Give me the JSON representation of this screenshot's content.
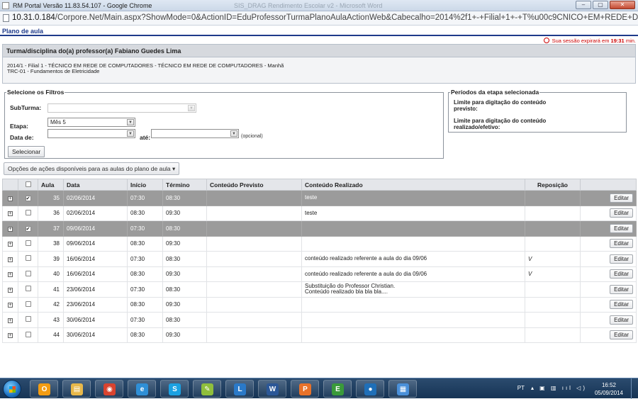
{
  "window": {
    "title": "RM Portal Versão 11.83.54.107 - Google Chrome",
    "blurred_title": "SIS_DRAG Rendimento Escolar v2 - Microsoft Word",
    "minimize": "–",
    "maximize": "▢",
    "close": "✕"
  },
  "address": {
    "host": "10.31.0.184",
    "path": "/Corpore.Net/Main.aspx?ShowMode=0&ActionID=EduProfessorTurmaPlanoAulaActionWeb&Cabecalho=2014%2f1+-+Filial+1+-+T%u00c9CNICO+EM+REDE+DE+CO"
  },
  "page": {
    "title": "Plano de aula",
    "session_prefix": "Sua sessão expirará em",
    "session_time": "19:31",
    "session_unit": "min."
  },
  "class_box": {
    "heading": "Turma/disciplina do(a) professor(a) Fabiano Guedes Lima",
    "line1": "2014/1 - Filial 1 - TÉCNICO EM REDE DE COMPUTADORES - TÉCNICO EM REDE DE COMPUTADORES - Manhã",
    "line2": "TRC-01 - Fundamentos de Eletricidade"
  },
  "filters": {
    "legend": "Selecione os Filtros",
    "subturma_label": "SubTurma:",
    "subturma_value": "",
    "etapa_label": "Etapa:",
    "etapa_value": "Mês 5",
    "data_de_label": "Data de:",
    "ate_label": "até:",
    "optional": "(opcional)",
    "select_button": "Selecionar"
  },
  "periods": {
    "legend": "Períodos da etapa selecionada",
    "previsto_label": "Limite para digitação do conteúdo previsto:",
    "realizado_label": "Limite para digitação do conteúdo realizado/efetivo:"
  },
  "actions_button": "Opções de ações disponíveis para as aulas do plano de aula ▾",
  "table": {
    "headers": [
      "",
      "",
      "Aula",
      "Data",
      "Início",
      "Término",
      "Conteúdo Previsto",
      "Conteúdo Realizado",
      "Reposição",
      ""
    ],
    "edit_label": "Editar",
    "rows": [
      {
        "aula": "35",
        "data": "02/06/2014",
        "inicio": "07:30",
        "termino": "08:30",
        "previsto": "",
        "realizado": "teste",
        "realizado2": "",
        "reposicao": "",
        "checked": "✔",
        "selected": true
      },
      {
        "aula": "36",
        "data": "02/06/2014",
        "inicio": "08:30",
        "termino": "09:30",
        "previsto": "",
        "realizado": "teste",
        "realizado2": "",
        "reposicao": "",
        "checked": "",
        "selected": false
      },
      {
        "aula": "37",
        "data": "09/06/2014",
        "inicio": "07:30",
        "termino": "08:30",
        "previsto": "",
        "realizado": "",
        "realizado2": "",
        "reposicao": "",
        "checked": "✔",
        "selected": true
      },
      {
        "aula": "38",
        "data": "09/06/2014",
        "inicio": "08:30",
        "termino": "09:30",
        "previsto": "",
        "realizado": "",
        "realizado2": "",
        "reposicao": "",
        "checked": "",
        "selected": false
      },
      {
        "aula": "39",
        "data": "16/06/2014",
        "inicio": "07:30",
        "termino": "08:30",
        "previsto": "",
        "realizado": "conteúdo realizado referente a aula do dia 09/06",
        "realizado2": "",
        "reposicao": "V",
        "checked": "",
        "selected": false
      },
      {
        "aula": "40",
        "data": "16/06/2014",
        "inicio": "08:30",
        "termino": "09:30",
        "previsto": "",
        "realizado": "conteúdo realizado referente a aula do dia 09/06",
        "realizado2": "",
        "reposicao": "V",
        "checked": "",
        "selected": false
      },
      {
        "aula": "41",
        "data": "23/06/2014",
        "inicio": "07:30",
        "termino": "08:30",
        "previsto": "",
        "realizado": "Substituição do Professor Christian.",
        "realizado2": "Conteúdo realizado bla bla bla....",
        "reposicao": "",
        "checked": "",
        "selected": false
      },
      {
        "aula": "42",
        "data": "23/06/2014",
        "inicio": "08:30",
        "termino": "09:30",
        "previsto": "",
        "realizado": "",
        "realizado2": "",
        "reposicao": "",
        "checked": "",
        "selected": false
      },
      {
        "aula": "43",
        "data": "30/06/2014",
        "inicio": "07:30",
        "termino": "08:30",
        "previsto": "",
        "realizado": "",
        "realizado2": "",
        "reposicao": "",
        "checked": "",
        "selected": false
      },
      {
        "aula": "44",
        "data": "30/06/2014",
        "inicio": "08:30",
        "termino": "09:30",
        "previsto": "",
        "realizado": "",
        "realizado2": "",
        "reposicao": "",
        "checked": "",
        "selected": false
      }
    ]
  },
  "taskbar": {
    "apps": [
      {
        "icon": "outlook-icon",
        "glyph": "O",
        "color": "#f39c12"
      },
      {
        "icon": "folder-icon",
        "glyph": "▤",
        "color": "#e8b84a"
      },
      {
        "icon": "chrome-icon",
        "glyph": "◉",
        "color": "#d9432f"
      },
      {
        "icon": "ie-icon",
        "glyph": "e",
        "color": "#2f8fd6"
      },
      {
        "icon": "skype-icon",
        "glyph": "S",
        "color": "#1ba1e2"
      },
      {
        "icon": "notes-icon",
        "glyph": "✎",
        "color": "#8fbf3c"
      },
      {
        "icon": "lync-icon",
        "glyph": "L",
        "color": "#2a79c8"
      },
      {
        "icon": "word-icon",
        "glyph": "W",
        "color": "#2b5797"
      },
      {
        "icon": "pdf-icon",
        "glyph": "P",
        "color": "#e8722a"
      },
      {
        "icon": "green-app-icon",
        "glyph": "E",
        "color": "#3a9a3a"
      },
      {
        "icon": "media-icon",
        "glyph": "●",
        "color": "#1f6fb8"
      },
      {
        "icon": "remote-desktop-icon",
        "glyph": "▦",
        "color": "#4a90d9"
      }
    ],
    "lang": "PT",
    "tray_icons": "▴ ▣ ▥ ııl ◁)",
    "time": "16:52",
    "date": "05/09/2014"
  }
}
